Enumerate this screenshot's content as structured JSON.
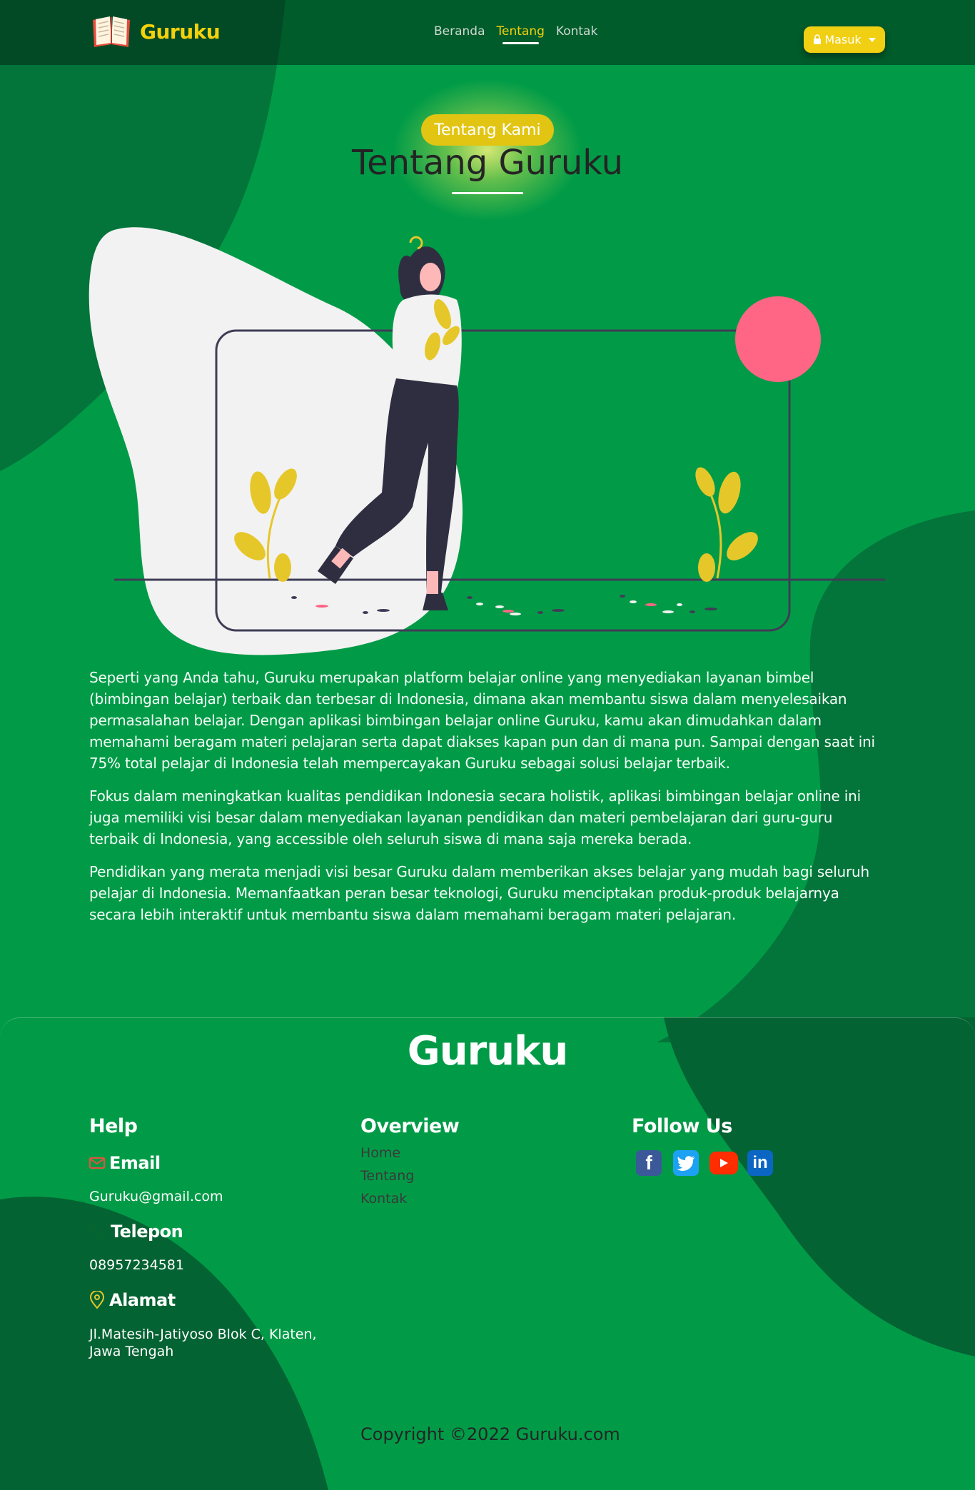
{
  "navbar": {
    "brand": "Guruku",
    "links": [
      "Beranda",
      "Tentang",
      "Kontak"
    ],
    "active_link": "Tentang",
    "login_label": "Masuk"
  },
  "header": {
    "badge": "Tentang Kami",
    "title": "Tentang Guruku"
  },
  "content": {
    "paragraphs": [
      "Seperti yang Anda tahu, Guruku merupakan platform belajar online yang menyediakan layanan bimbel (bimbingan belajar) terbaik dan terbesar di Indonesia, dimana akan membantu siswa dalam menyelesaikan permasalahan belajar. Dengan aplikasi bimbingan belajar online Guruku, kamu akan dimudahkan dalam memahami beragam materi pelajaran serta dapat diakses kapan pun dan di mana pun. Sampai dengan saat ini 75% total pelajar di Indonesia telah mempercayakan Guruku sebagai solusi belajar terbaik.",
      "Fokus dalam meningkatkan kualitas pendidikan Indonesia secara holistik, aplikasi bimbingan belajar online ini juga memiliki visi besar dalam menyediakan layanan pendidikan dan materi pembelajaran dari guru-guru terbaik di Indonesia, yang accessible oleh seluruh siswa di mana saja mereka berada.",
      "Pendidikan yang merata menjadi visi besar Guruku dalam memberikan akses belajar yang mudah bagi seluruh pelajar di Indonesia. Memanfaatkan peran besar teknologi, Guruku menciptakan produk-produk belajarnya secara lebih interaktif untuk membantu siswa dalam memahami beragam materi pelajaran."
    ]
  },
  "footer": {
    "brand": "Guruku",
    "help": {
      "title": "Help",
      "email_label": "Email",
      "email_value": "Guruku@gmail.com",
      "phone_label": "Telepon",
      "phone_value": "08957234581",
      "address_label": "Alamat",
      "address_line1": "Jl.Matesih-Jatiyoso Blok C, Klaten,",
      "address_line2": "Jawa Tengah"
    },
    "overview": {
      "title": "Overview",
      "links": [
        "Home",
        "Tentang",
        "Kontak"
      ]
    },
    "follow": {
      "title": "Follow Us",
      "icons": [
        "facebook-icon",
        "twitter-icon",
        "youtube-icon",
        "linkedin-icon"
      ],
      "colors": [
        "#3b5998",
        "#1da1f2",
        "#ff2d00",
        "#0a66c2"
      ]
    },
    "copyright": "Copyright ©2022 Guruku.com"
  }
}
